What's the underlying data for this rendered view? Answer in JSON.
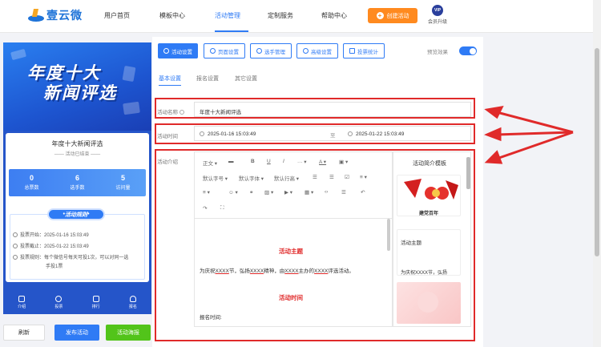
{
  "nav": {
    "logo_text": "壹云微",
    "items": [
      "用户首页",
      "模板中心",
      "活动管理",
      "定制服务",
      "帮助中心"
    ],
    "create_label": "创建活动",
    "vip_badge": "VIP",
    "vip_label": "会员升级"
  },
  "preview": {
    "banner_line1": "年度十大",
    "banner_line2": "新闻评选",
    "card_title": "年度十大新闻评选",
    "card_status": "活动已结束",
    "stats": [
      {
        "value": "0",
        "label": "总票数"
      },
      {
        "value": "6",
        "label": "选手数"
      },
      {
        "value": "5",
        "label": "访问量"
      }
    ],
    "rules_button": "活动规则",
    "rules": [
      "投票开始：2025-01-16 15:03:49",
      "投票截止：2025-01-22 15:03:49",
      "投票规则：每个微信号每天可投1次，可以对同一选",
      "手投1票"
    ],
    "tabs": [
      "介绍",
      "投票",
      "排行",
      "报名"
    ]
  },
  "bottom_buttons": {
    "refresh": "刷新",
    "publish": "发布活动",
    "poster": "活动海报"
  },
  "toolbar": {
    "buttons": [
      "活动设置",
      "页面设置",
      "选手管理",
      "高级设置",
      "投票统计"
    ],
    "preview_label": "预览效果"
  },
  "subtabs": [
    "基本设置",
    "报名设置",
    "其它设置"
  ],
  "form": {
    "name_label": "活动名称",
    "name_value": "年度十大新闻评选",
    "time_label": "活动时间",
    "start_time": "2025-01-16 15:03:49",
    "separator": "至",
    "end_time": "2025-01-22 15:03:49",
    "intro_label": "活动介绍"
  },
  "editor": {
    "toolbar_row1": [
      "正文",
      "B",
      "U",
      "I",
      "···",
      "A",
      "A"
    ],
    "toolbar_row2": [
      "默认字号",
      "默认字体",
      "默认行高"
    ],
    "heading1": "活动主题",
    "para1_a": "为庆祝",
    "para1_b": "XXXX",
    "para1_c": "节，弘扬",
    "para1_d": "XXXX",
    "para1_e": "精神，由",
    "para1_f": "XXXX",
    "para1_g": "主办的",
    "para1_h": "XXXX",
    "para1_i": "评选活动。",
    "heading2": "活动时间",
    "para2": "报名时间:"
  },
  "templates": {
    "title": "活动简介模板",
    "card1_text": "建党百年",
    "card2_title": "活动主题",
    "card2_text": "为庆祝XXXX节，弘扬"
  },
  "colors": {
    "accent": "#2f7bf5",
    "orange": "#ff8a1f",
    "green": "#52c41a",
    "highlight": "#e02a2a"
  }
}
